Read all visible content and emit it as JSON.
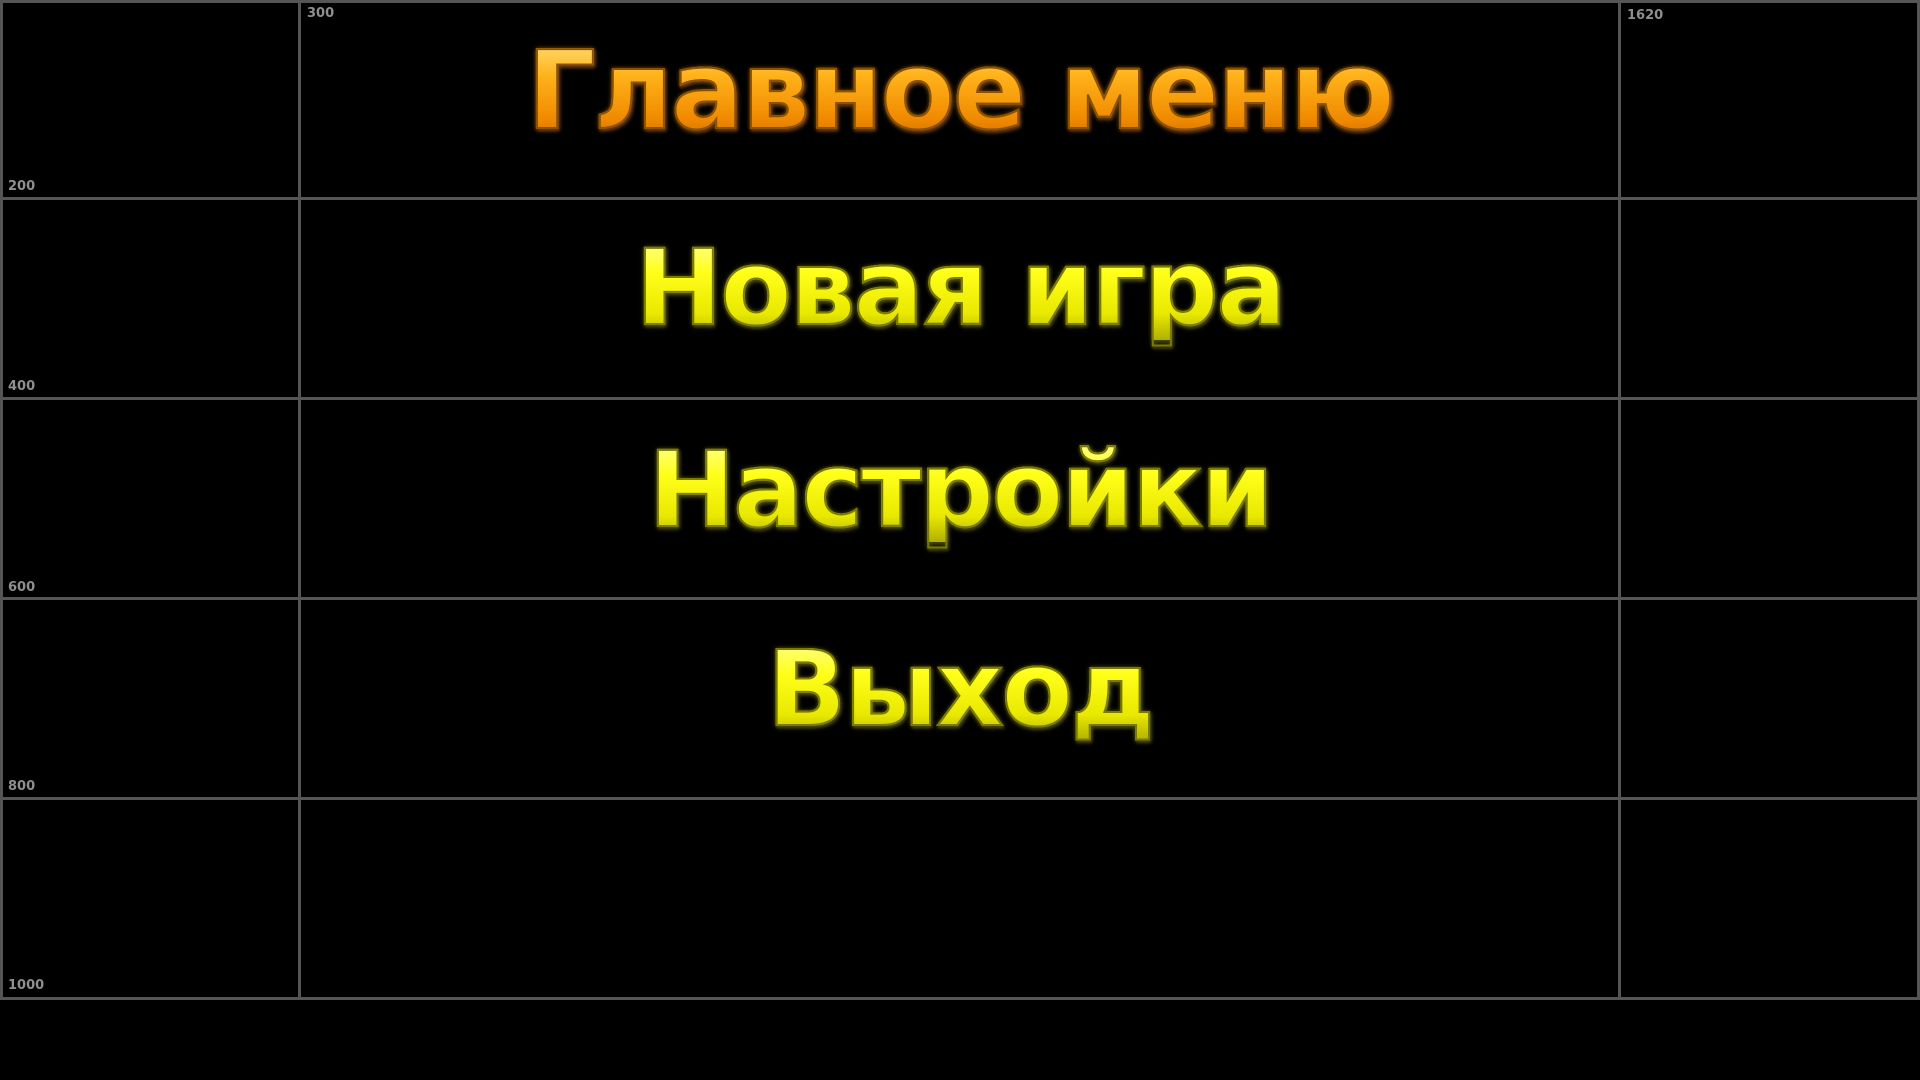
{
  "grid": {
    "line_color": "#555555",
    "label_color": "#8f8f8f",
    "labels": {
      "x300": "300",
      "x1620": "1620",
      "y200": "200",
      "y400": "400",
      "y600": "600",
      "y800": "800",
      "y1000": "1000"
    }
  },
  "menu": {
    "title": "Главное меню",
    "title_color": "#ffa600",
    "item_color": "#ffff00",
    "items": [
      {
        "label": "Новая игра"
      },
      {
        "label": "Настройки"
      },
      {
        "label": "Выход"
      }
    ]
  }
}
